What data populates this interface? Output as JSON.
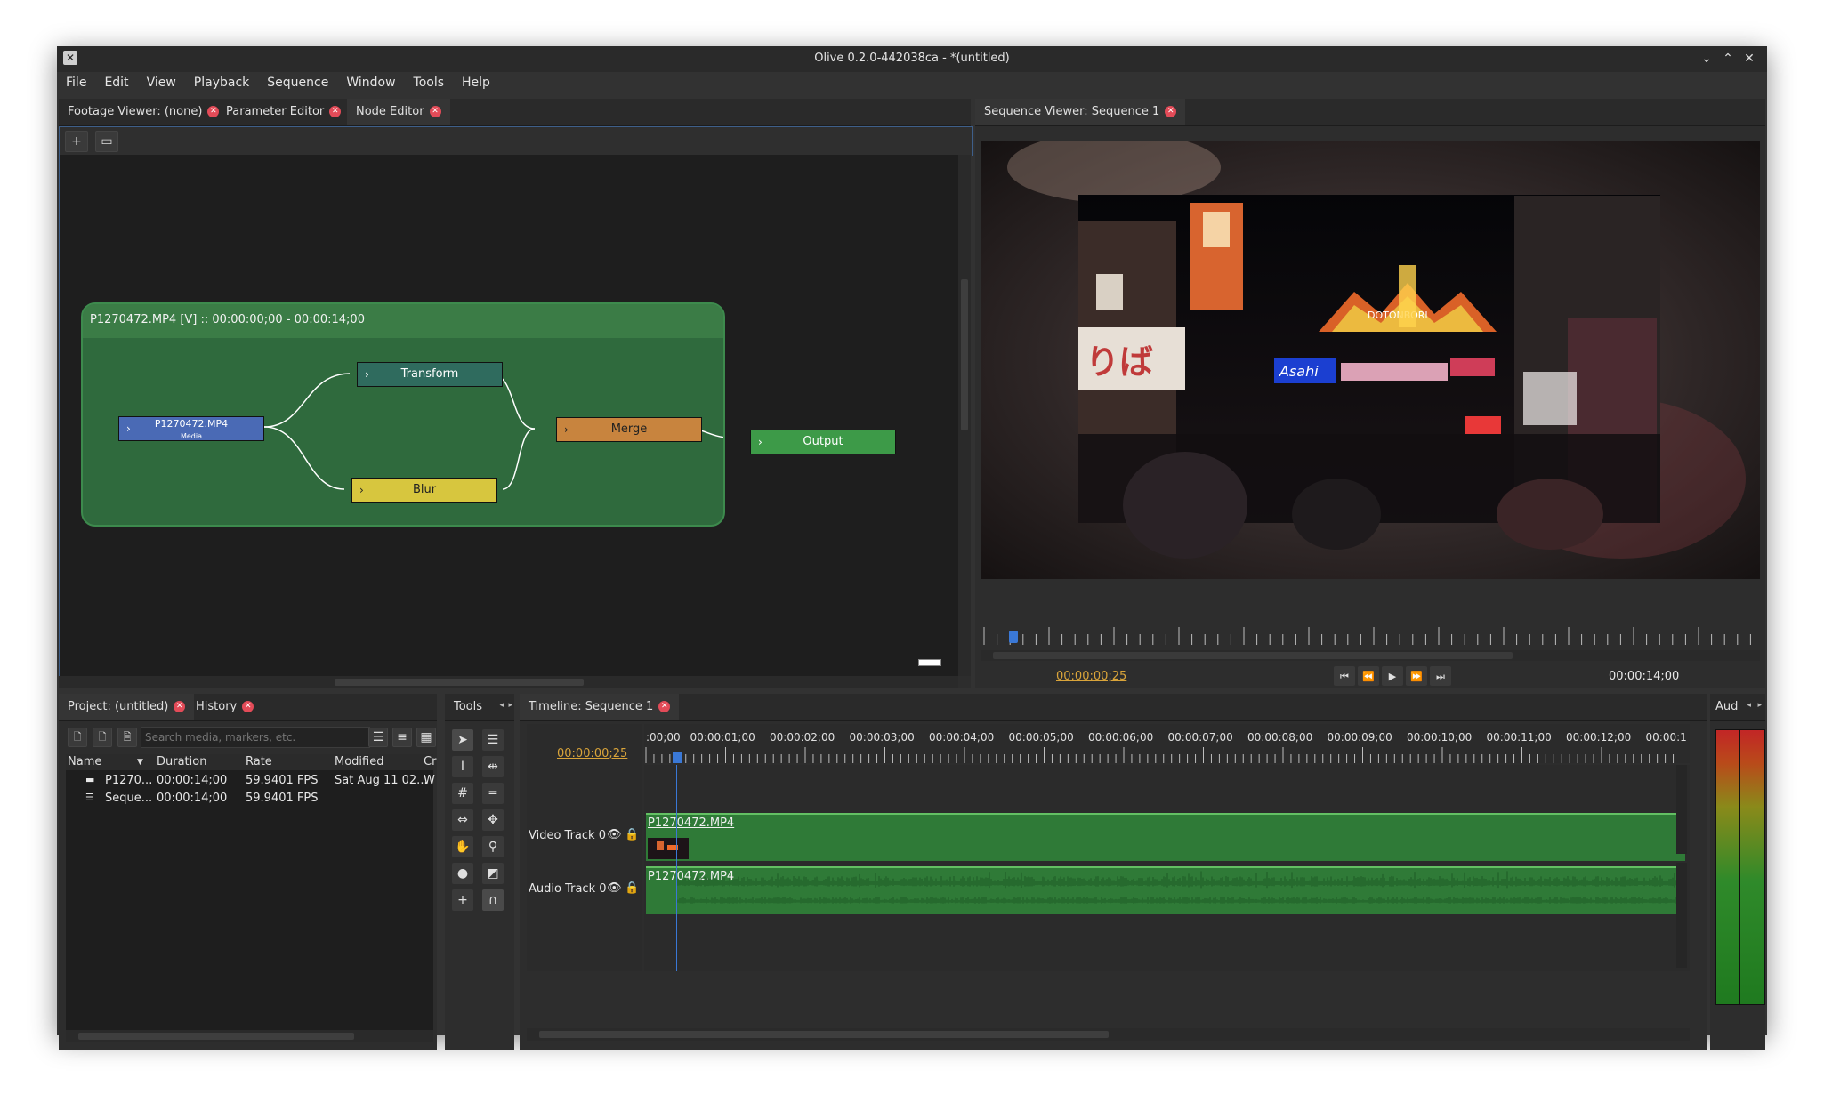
{
  "window": {
    "title": "Olive 0.2.0-442038ca - *(untitled)"
  },
  "menu": [
    "File",
    "Edit",
    "View",
    "Playback",
    "Sequence",
    "Window",
    "Tools",
    "Help"
  ],
  "left_panel": {
    "tabs": [
      "Footage Viewer: (none)",
      "Parameter Editor",
      "Node Editor"
    ],
    "active_tab": "Node Editor",
    "toolbar": {
      "add_label": "+",
      "fit_label": "▭"
    }
  },
  "node_editor": {
    "group_title": "P1270472.MP4 [V] :: 00:00:00;00 - 00:00:14;00",
    "nodes": {
      "media": {
        "title": "P1270472.MP4",
        "subtitle": "Media",
        "color": "#4a6ab5"
      },
      "transform": {
        "title": "Transform",
        "color": "#2f6b5e"
      },
      "blur": {
        "title": "Blur",
        "color": "#d7c63e"
      },
      "merge": {
        "title": "Merge",
        "color": "#c8843e"
      },
      "output": {
        "title": "Output",
        "color": "#3d9a48"
      }
    }
  },
  "sequence_viewer": {
    "tab": "Sequence Viewer: Sequence 1",
    "current_time": "00:00:00;25",
    "end_time": "00:00:14;00",
    "controls": [
      "go-to-start",
      "rewind",
      "play",
      "fast-forward",
      "go-to-end"
    ]
  },
  "project_panel": {
    "tabs": [
      "Project: (untitled)",
      "History"
    ],
    "search_placeholder": "Search media, markers, etc.",
    "columns": [
      "Name",
      "Duration",
      "Rate",
      "Modified",
      "Cr"
    ],
    "rows": [
      {
        "icon": "video-clip-icon",
        "name": "P1270...",
        "duration": "00:00:14;00",
        "rate": "59.9401 FPS",
        "modified": "Sat Aug 11 02...",
        "extra": "W"
      },
      {
        "icon": "sequence-icon",
        "name": "Seque...",
        "duration": "00:00:14;00",
        "rate": "59.9401 FPS",
        "modified": "",
        "extra": ""
      }
    ]
  },
  "tools_panel": {
    "title": "Tools"
  },
  "timeline": {
    "tab": "Timeline: Sequence 1",
    "current_time": "00:00:00;25",
    "ruler_labels": [
      ":00;00",
      "00:00:01;00",
      "00:00:02;00",
      "00:00:03;00",
      "00:00:04;00",
      "00:00:05;00",
      "00:00:06;00",
      "00:00:07;00",
      "00:00:08;00",
      "00:00:09;00",
      "00:00:10;00",
      "00:00:11;00",
      "00:00:12;00",
      "00:00:1"
    ],
    "tracks": [
      {
        "name": "Video Track 0",
        "clip": "P1270472.MP4",
        "type": "video"
      },
      {
        "name": "Audio Track 0",
        "clip": "P1270472.MP4",
        "type": "audio"
      }
    ]
  },
  "audio_monitor": {
    "title": "Aud"
  }
}
